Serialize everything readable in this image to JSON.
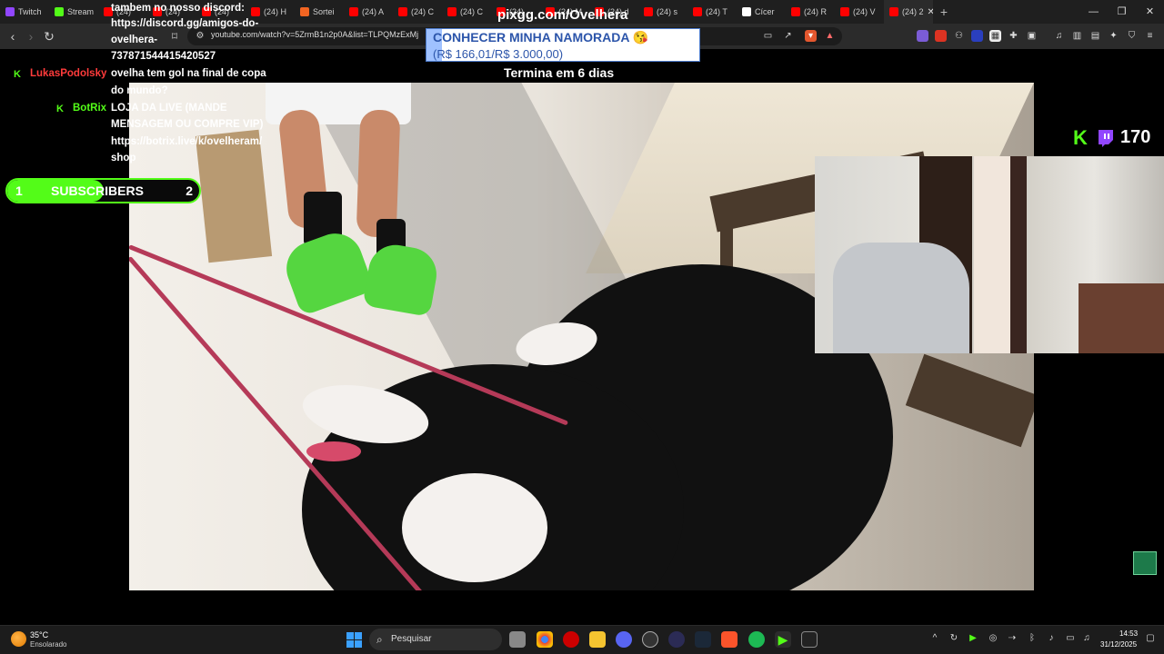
{
  "browser": {
    "tabs": [
      {
        "label": "Twitch",
        "favicon_color": "#9146ff"
      },
      {
        "label": "Stream",
        "favicon_color": "#53fc18"
      },
      {
        "label": "(24)",
        "favicon_color": "#ff0000"
      },
      {
        "label": "(24)",
        "favicon_color": "#ff0000"
      },
      {
        "label": "(24)",
        "favicon_color": "#ff0000"
      },
      {
        "label": "(24) H",
        "favicon_color": "#ff0000"
      },
      {
        "label": "Sortei",
        "favicon_color": "#f26522"
      },
      {
        "label": "(24) A",
        "favicon_color": "#ff0000"
      },
      {
        "label": "(24) C",
        "favicon_color": "#ff0000"
      },
      {
        "label": "(24) C",
        "favicon_color": "#ff0000"
      },
      {
        "label": "(24)",
        "favicon_color": "#ff0000"
      },
      {
        "label": "(24) M",
        "favicon_color": "#ff0000"
      },
      {
        "label": "(24) d",
        "favicon_color": "#ff0000"
      },
      {
        "label": "(24) s",
        "favicon_color": "#ff0000"
      },
      {
        "label": "(24) T",
        "favicon_color": "#ff0000"
      },
      {
        "label": "Cícer",
        "favicon_color": "#ffffff"
      },
      {
        "label": "(24) R",
        "favicon_color": "#ff0000"
      },
      {
        "label": "(24) V",
        "favicon_color": "#ff0000"
      },
      {
        "label": "(24) 2",
        "favicon_color": "#ff0000"
      }
    ],
    "url": "youtube.com/watch?v=5ZrmB1n2p0A&list=TLPQMzExMj"
  },
  "overlay": {
    "topline": "pixgg.com/Ovelhera",
    "goal_title": "CONHECER MINHA NAMORADA 😘",
    "goal_amount": "(R$ 166,01/R$ 3.000,00)",
    "goal_progress": 0.055,
    "goal_ends": "Termina em 6 dias",
    "subscribers": {
      "left": "1",
      "label": "SUBSCRIBERS",
      "right": "2",
      "progress": 0.5
    },
    "viewers": "170"
  },
  "chat": {
    "line1": "tambem no nosso discord:",
    "line2": "https://discord.gg/amigos-do-",
    "line3": "ovelhera-",
    "line4": "737871544415420527",
    "msg2_user": "LukasPodolsky",
    "msg2_line1": "ovelha tem gol na final de copa",
    "msg2_line2": "do mundo?",
    "msg3_user": "BotRix",
    "msg3_line1": "LOJA DA LIVE (MANDE",
    "msg3_line2": "MENSAGEM OU COMPRE VIP)",
    "msg3_line3": "https://botrix.live/k/ovelheram/",
    "msg3_line4": "shop"
  },
  "taskbar": {
    "temperature": "35°C",
    "condition": "Ensolarado",
    "search_placeholder": "Pesquisar",
    "time": "14:53",
    "date": "31/12/2025"
  },
  "colors": {
    "kick_green": "#53fc18",
    "goal_blue": "#2c55aa",
    "lukas_red": "#ff3b3b"
  }
}
